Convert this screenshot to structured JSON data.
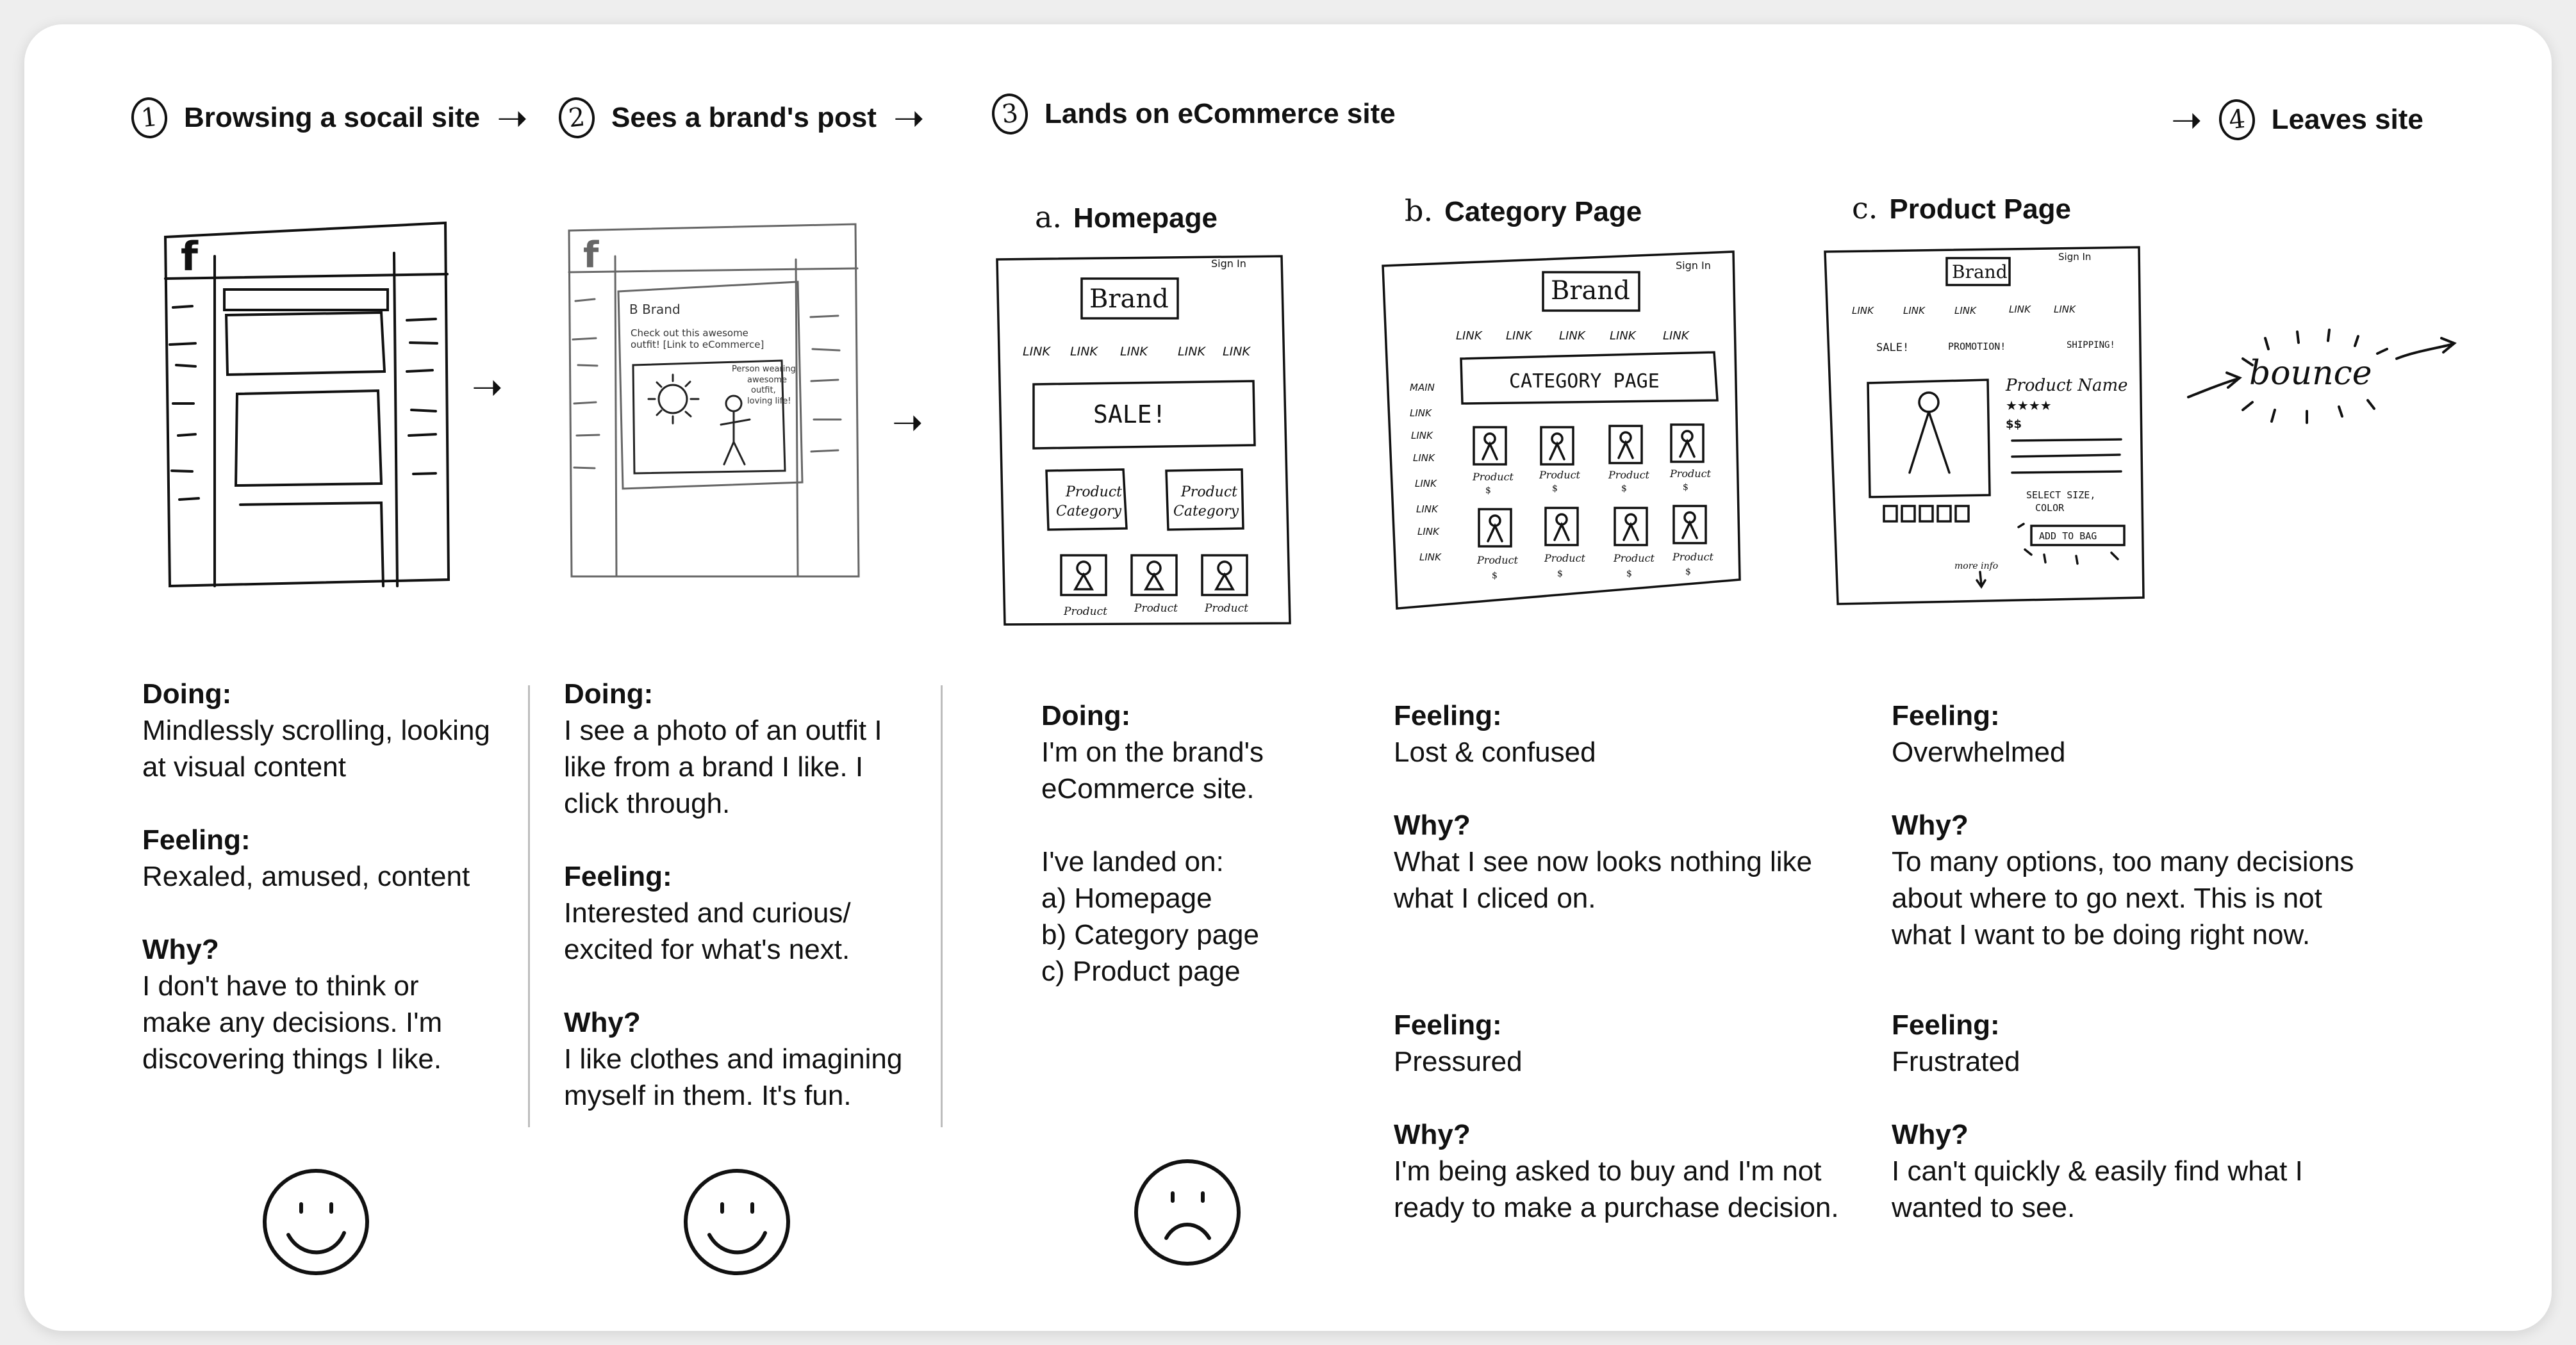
{
  "steps": [
    {
      "num": "1",
      "title": "Browsing a socail site"
    },
    {
      "num": "2",
      "title": "Sees a brand's post"
    },
    {
      "num": "3",
      "title": "Lands on eCommerce site"
    },
    {
      "num": "4",
      "title": "Leaves site"
    }
  ],
  "substeps": [
    {
      "letter": "a.",
      "title": "Homepage"
    },
    {
      "letter": "b.",
      "title": "Category Page"
    },
    {
      "letter": "c.",
      "title": "Product Page"
    }
  ],
  "sketches": {
    "social_logo": "f",
    "post": {
      "brand": "B  Brand",
      "caption1": "Check out this awesome",
      "caption2": "outfit! [Link to eCommerce]",
      "note1": "Person wearing",
      "note2": "awesome",
      "note3": "outfit,",
      "note4": "loving life!"
    },
    "homepage": {
      "signin": "Sign In",
      "brand": "Brand",
      "links": [
        "LINK",
        "LINK",
        "LINK",
        "LINK",
        "LINK"
      ],
      "sale": "SALE!",
      "cat1a": "Product",
      "cat1b": "Category",
      "cat2a": "Product",
      "cat2b": "Category",
      "product": "Product"
    },
    "category": {
      "signin": "Sign In",
      "brand": "Brand",
      "links": [
        "LINK",
        "LINK",
        "LINK",
        "LINK",
        "LINK"
      ],
      "side_links": [
        "MAIN",
        "LINK",
        "LINK",
        "LINK",
        "LINK",
        "LINK",
        "LINK",
        "LINK"
      ],
      "title": "CATEGORY PAGE",
      "product": "Product",
      "price": "$"
    },
    "product": {
      "signin": "Sign In",
      "brand": "Brand",
      "links": [
        "LINK",
        "LINK",
        "LINK",
        "LINK",
        "LINK"
      ],
      "promo": [
        "SALE!",
        "PROMOTION!",
        "SHIPPING!"
      ],
      "name": "Product Name",
      "stars": "★★★★",
      "price": "$$",
      "select1": "SELECT SIZE,",
      "select2": "COLOR",
      "add": "ADD TO BAG",
      "more": "more info"
    },
    "bounce": "bounce"
  },
  "columns": [
    {
      "sections": [
        {
          "label": "Doing:",
          "lines": [
            "Mindlessly scrolling, looking",
            "at visual content"
          ]
        },
        {
          "label": "Feeling:",
          "lines": [
            "Rexaled, amused, content"
          ]
        },
        {
          "label": "Why?",
          "lines": [
            "I don't have to think or",
            "make any decisions. I'm",
            "discovering things I like."
          ]
        }
      ],
      "face": "happy"
    },
    {
      "sections": [
        {
          "label": "Doing:",
          "lines": [
            "I see a photo of an outfit I",
            "like from a brand I like. I",
            "click through."
          ]
        },
        {
          "label": "Feeling:",
          "lines": [
            "Interested and curious/",
            "excited for what's next."
          ]
        },
        {
          "label": "Why?",
          "lines": [
            "I like clothes and imagining",
            "myself in them. It's fun."
          ]
        }
      ],
      "face": "happy"
    },
    {
      "sections": [
        {
          "label": "Doing:",
          "lines": [
            "I'm on the brand's",
            "eCommerce site."
          ]
        },
        {
          "label": "",
          "lines": [
            "I've landed on:",
            "a) Homepage",
            "b) Category page",
            "c) Product page"
          ]
        }
      ],
      "face": "sad"
    },
    {
      "sections": [
        {
          "label": "Feeling:",
          "lines": [
            "Lost & confused"
          ]
        },
        {
          "label": "Why?",
          "lines": [
            "What I see now looks nothing like",
            "what I cliced on."
          ]
        }
      ],
      "lower": [
        {
          "label": "Feeling:",
          "lines": [
            "Pressured"
          ]
        },
        {
          "label": "Why?",
          "lines": [
            "I'm being asked to buy and I'm not",
            "ready to make a purchase decision."
          ]
        }
      ]
    },
    {
      "sections": [
        {
          "label": "Feeling:",
          "lines": [
            "Overwhelmed"
          ]
        },
        {
          "label": "Why?",
          "lines": [
            "To many options, too many decisions",
            "about where to go next. This is not",
            "what I want to be doing right now."
          ]
        }
      ],
      "lower": [
        {
          "label": "Feeling:",
          "lines": [
            "Frustrated"
          ]
        },
        {
          "label": "Why?",
          "lines": [
            "I can't quickly & easily find what I",
            "wanted to see."
          ]
        }
      ]
    }
  ]
}
